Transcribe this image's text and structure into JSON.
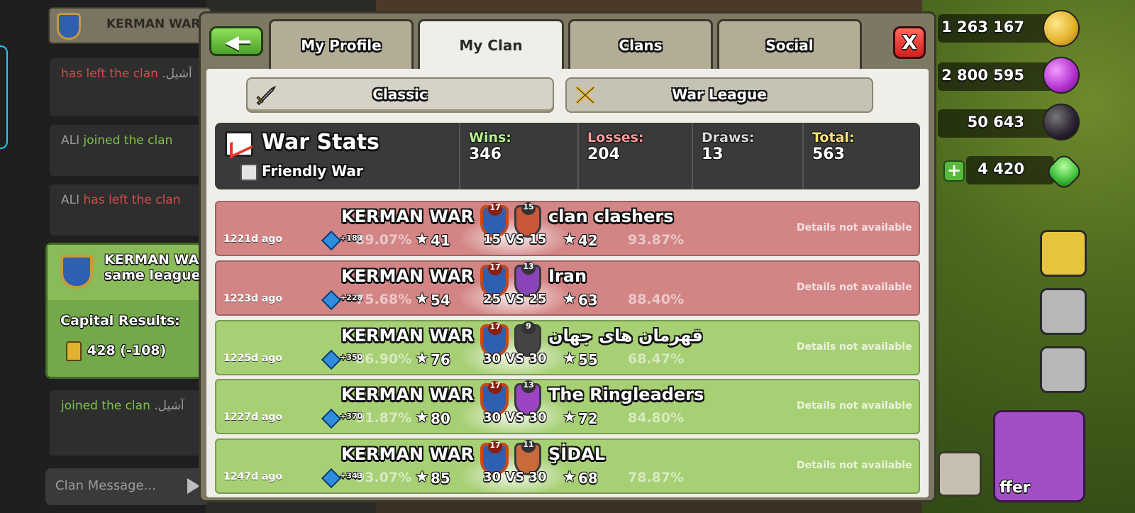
{
  "chat": {
    "header_name": "KERMAN WAR",
    "messages": [
      {
        "parts": [
          {
            "text": "has left the clan",
            "tone": "red"
          },
          {
            "text": " .آشیل",
            "tone": "gray"
          }
        ]
      },
      {
        "parts": [
          {
            "text": "ALI ",
            "tone": "gray"
          },
          {
            "text": "joined the clan",
            "tone": "green"
          }
        ]
      },
      {
        "parts": [
          {
            "text": "ALI ",
            "tone": "gray"
          },
          {
            "text": "has left the clan",
            "tone": "red"
          }
        ]
      },
      {
        "parts": [
          {
            "text": "joined the clan",
            "tone": "green"
          },
          {
            "text": " .آشیل",
            "tone": "gray"
          }
        ]
      }
    ],
    "card": {
      "title_line1": "KERMAN WA",
      "title_line2": "same league",
      "capital_label": "Capital Results:",
      "capital_value": "428 (-108)"
    },
    "input_placeholder": "Clan Message..."
  },
  "resources": {
    "gold": "1 263 167",
    "elixir": "2 800 595",
    "dark_elixir": "50 643",
    "gems": "4 420"
  },
  "shop_label": "ffer",
  "dialog": {
    "tabs": [
      "My Profile",
      "My Clan",
      "Clans",
      "Social"
    ],
    "active_tab": "My Clan",
    "close_label": "X",
    "subtabs": [
      "Classic",
      "War League"
    ]
  },
  "war_stats": {
    "title": "War Stats",
    "friendly_label": "Friendly War",
    "columns": [
      {
        "label": "Wins:",
        "value": "346",
        "color": "#b6f28e"
      },
      {
        "label": "Losses:",
        "value": "204",
        "color": "#ff9a9a"
      },
      {
        "label": "Draws:",
        "value": "13",
        "color": "#d8d8d8"
      },
      {
        "label": "Total:",
        "value": "563",
        "color": "#ffe27a"
      }
    ]
  },
  "wars": [
    {
      "result": "lost",
      "ago": "1221d ago",
      "our_clan": "KERMAN WAR",
      "our_level": "17",
      "opp_clan": "clan clashers",
      "opp_level": "15",
      "opp_color": "#c9573a",
      "xp": "+183",
      "our_pct": "89.07%",
      "our_stars": "41",
      "size": "15 VS 15",
      "opp_stars": "42",
      "opp_pct": "93.87%",
      "details": "Details not available"
    },
    {
      "result": "lost",
      "ago": "1223d ago",
      "our_clan": "KERMAN WAR",
      "our_level": "17",
      "opp_clan": "Iran",
      "opp_level": "13",
      "opp_color": "#8b43b8",
      "xp": "+228",
      "our_pct": "75.68%",
      "our_stars": "54",
      "size": "25 VS 25",
      "opp_stars": "63",
      "opp_pct": "88.40%",
      "details": "Details not available"
    },
    {
      "result": "won",
      "ago": "1225d ago",
      "our_clan": "KERMAN WAR",
      "our_level": "17",
      "opp_clan": "قهرمان های جهان",
      "opp_level": "9",
      "opp_color": "#454545",
      "xp": "+350",
      "our_pct": "86.90%",
      "our_stars": "76",
      "size": "30 VS 30",
      "opp_stars": "55",
      "opp_pct": "68.47%",
      "details": "Details not available"
    },
    {
      "result": "won",
      "ago": "1227d ago",
      "our_clan": "KERMAN WAR",
      "our_level": "17",
      "opp_clan": "The Ringleaders",
      "opp_level": "13",
      "opp_color": "#9b45c2",
      "xp": "+370",
      "our_pct": "91.87%",
      "our_stars": "80",
      "size": "30 VS 30",
      "opp_stars": "72",
      "opp_pct": "84.80%",
      "details": "Details not available"
    },
    {
      "result": "won",
      "ago": "1247d ago",
      "our_clan": "KERMAN WAR",
      "our_level": "17",
      "opp_clan": "ŞİDAL",
      "opp_level": "11",
      "opp_color": "#c86a3a",
      "xp": "+343",
      "our_pct": "93.07%",
      "our_stars": "85",
      "size": "30 VS 30",
      "opp_stars": "68",
      "opp_pct": "78.87%",
      "details": "Details not available"
    }
  ]
}
